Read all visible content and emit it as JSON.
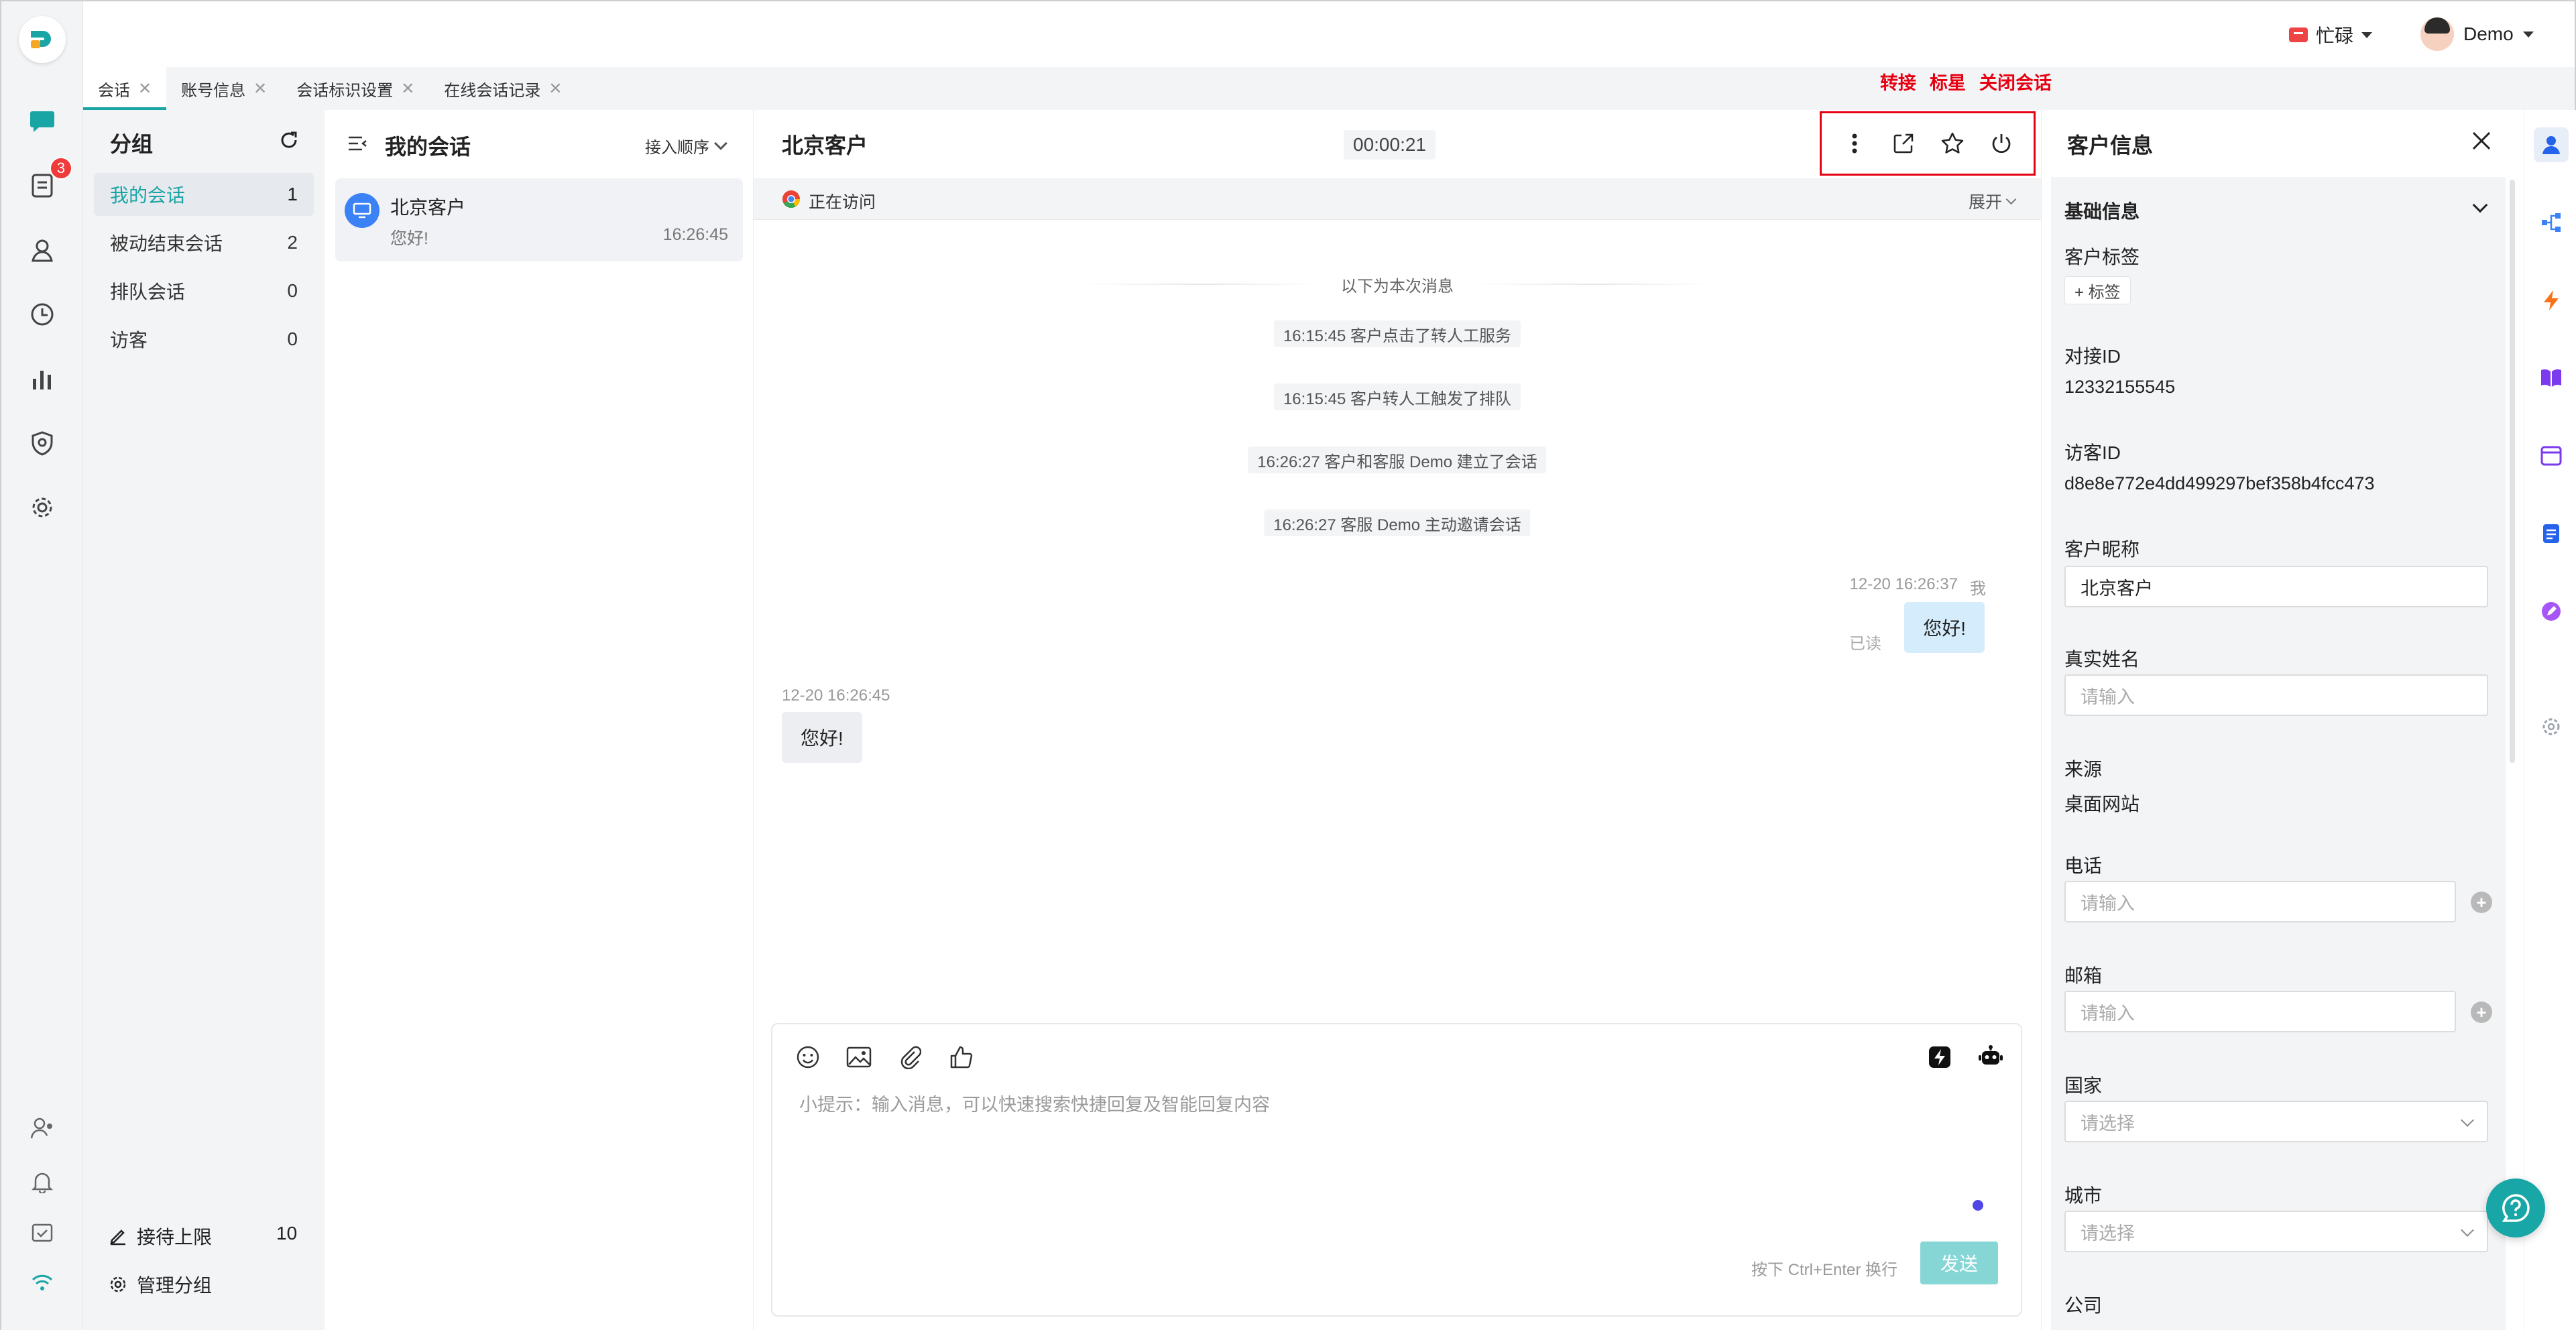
{
  "topbar": {
    "status_label": "忙碌",
    "user_name": "Demo"
  },
  "tabs": [
    {
      "label": "会话",
      "active": true
    },
    {
      "label": "账号信息",
      "active": false
    },
    {
      "label": "会话标识设置",
      "active": false
    },
    {
      "label": "在线会话记录",
      "active": false
    }
  ],
  "annotations": {
    "transfer": "转接",
    "star": "标星",
    "close_session": "关闭会话"
  },
  "rail": {
    "badge_count": "3"
  },
  "groups": {
    "title": "分组",
    "items": [
      {
        "label": "我的会话",
        "count": "1",
        "active": true
      },
      {
        "label": "被动结束会话",
        "count": "2",
        "active": false
      },
      {
        "label": "排队会话",
        "count": "0",
        "active": false
      },
      {
        "label": "访客",
        "count": "0",
        "active": false
      }
    ],
    "limit_label": "接待上限",
    "limit_value": "10",
    "manage_label": "管理分组"
  },
  "conversations": {
    "title": "我的会话",
    "order_label": "接入顺序",
    "items": [
      {
        "name": "北京客户",
        "last_message": "您好!",
        "time": "16:26:45"
      }
    ]
  },
  "chat": {
    "title": "北京客户",
    "timer": "00:00:21",
    "visiting_label": "正在访问",
    "expand_label": "展开",
    "divider_label": "以下为本次消息",
    "system_messages": [
      "16:15:45 客户点击了转人工服务",
      "16:15:45 客户转人工触发了排队",
      "16:26:27 客户和客服 Demo 建立了会话",
      "16:26:27 客服 Demo 主动邀请会话"
    ],
    "outgoing": {
      "time": "12-20 16:26:37",
      "sender": "我",
      "text": "您好!",
      "read_label": "已读"
    },
    "incoming": {
      "time": "12-20 16:26:45",
      "text": "您好!"
    },
    "composer": {
      "placeholder": "小提示：输入消息，可以快速搜索快捷回复及智能回复内容",
      "hint": "按下 Ctrl+Enter 换行",
      "send_label": "发送"
    }
  },
  "customer_info": {
    "title": "客户信息",
    "section_title": "基础信息",
    "tags_label": "客户标签",
    "add_tag_label": "+ 标签",
    "session_id_label": "对接ID",
    "session_id": "12332155545",
    "visitor_id_label": "访客ID",
    "visitor_id": "d8e8e772e4dd499297bef358b4fcc473",
    "nickname_label": "客户昵称",
    "nickname": "北京客户",
    "realname_label": "真实姓名",
    "realname_placeholder": "请输入",
    "source_label": "来源",
    "source": "桌面网站",
    "phone_label": "电话",
    "phone_placeholder": "请输入",
    "email_label": "邮箱",
    "email_placeholder": "请输入",
    "country_label": "国家",
    "country_placeholder": "请选择",
    "city_label": "城市",
    "city_placeholder": "请选择",
    "company_label": "公司"
  },
  "colors": {
    "accent": "#1aa5a5",
    "annotation": "#e60012",
    "badge": "#f03b3b",
    "outgoing_bubble": "#d4ecfb"
  }
}
